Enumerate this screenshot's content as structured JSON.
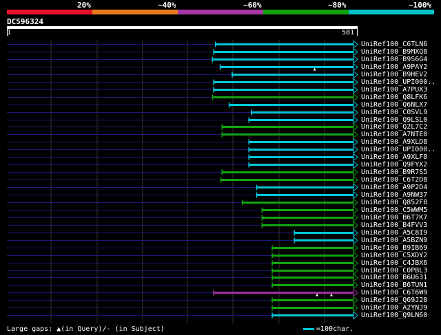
{
  "scale": {
    "labels": [
      "20%",
      "~40%",
      "~60%",
      "~80%",
      "~100%"
    ],
    "colors": [
      "#e8102a",
      "#e87a1e",
      "#a838a8",
      "#10a010",
      "#00c0c8"
    ]
  },
  "query": {
    "name": "DC596324",
    "start": "1",
    "end": "581",
    "length": 581
  },
  "colors": {
    "cyan": "#00c8dc",
    "green": "#10a810",
    "purple": "#a030a0",
    "track": "#1a1a7a",
    "grid": "#333333"
  },
  "hits": [
    {
      "label": "UniRef100_C6TLN6",
      "start": 350,
      "end": 581,
      "color": "cyan"
    },
    {
      "label": "UniRef100_B9MXQ8",
      "start": 347,
      "end": 581,
      "color": "cyan"
    },
    {
      "label": "UniRef100_B9S6G4",
      "start": 345,
      "end": 581,
      "color": "cyan"
    },
    {
      "label": "UniRef100_A9PAY2",
      "start": 358,
      "end": 581,
      "color": "cyan",
      "gap_at": 516
    },
    {
      "label": "UniRef100_B9HEV2",
      "start": 378,
      "end": 581,
      "color": "cyan"
    },
    {
      "label": "UniRef100_UPI000..",
      "start": 347,
      "end": 581,
      "color": "cyan"
    },
    {
      "label": "UniRef100_A7PUX3",
      "start": 347,
      "end": 581,
      "color": "cyan"
    },
    {
      "label": "UniRef100_Q8LFK6",
      "start": 345,
      "end": 581,
      "color": "green"
    },
    {
      "label": "UniRef100_Q6NLX7",
      "start": 373,
      "end": 581,
      "color": "cyan"
    },
    {
      "label": "UniRef100_C0SVL9",
      "start": 410,
      "end": 581,
      "color": "cyan"
    },
    {
      "label": "UniRef100_Q9LSL0",
      "start": 406,
      "end": 581,
      "color": "cyan"
    },
    {
      "label": "UniRef100_Q2L7C2",
      "start": 361,
      "end": 581,
      "color": "green"
    },
    {
      "label": "UniRef100_A7NTE0",
      "start": 361,
      "end": 581,
      "color": "green"
    },
    {
      "label": "UniRef100_A9XLD8",
      "start": 406,
      "end": 581,
      "color": "cyan"
    },
    {
      "label": "UniRef100_UPI000..",
      "start": 406,
      "end": 581,
      "color": "cyan"
    },
    {
      "label": "UniRef100_A9XLF8",
      "start": 406,
      "end": 581,
      "color": "cyan"
    },
    {
      "label": "UniRef100_Q9FYX2",
      "start": 406,
      "end": 581,
      "color": "cyan"
    },
    {
      "label": "UniRef100_B9R7S5",
      "start": 361,
      "end": 581,
      "color": "green"
    },
    {
      "label": "UniRef100_C6T2D8",
      "start": 359,
      "end": 581,
      "color": "green"
    },
    {
      "label": "UniRef100_A9P2D4",
      "start": 419,
      "end": 581,
      "color": "cyan"
    },
    {
      "label": "UniRef100_A9NW37",
      "start": 419,
      "end": 581,
      "color": "cyan"
    },
    {
      "label": "UniRef100_Q852F8",
      "start": 395,
      "end": 581,
      "color": "green"
    },
    {
      "label": "UniRef100_C5WWM5",
      "start": 428,
      "end": 581,
      "color": "green"
    },
    {
      "label": "UniRef100_B6T7K7",
      "start": 428,
      "end": 581,
      "color": "green"
    },
    {
      "label": "UniRef100_B4FVV3",
      "start": 428,
      "end": 581,
      "color": "green"
    },
    {
      "label": "UniRef100_A5C8I9",
      "start": 482,
      "end": 581,
      "color": "cyan"
    },
    {
      "label": "UniRef100_A5BZN9",
      "start": 482,
      "end": 581,
      "color": "cyan"
    },
    {
      "label": "UniRef100_B9IB69",
      "start": 445,
      "end": 581,
      "color": "green"
    },
    {
      "label": "UniRef100_C5XDY2",
      "start": 445,
      "end": 581,
      "color": "green"
    },
    {
      "label": "UniRef100_C4JBX6",
      "start": 445,
      "end": 581,
      "color": "green"
    },
    {
      "label": "UniRef100_C0PBL3",
      "start": 445,
      "end": 581,
      "color": "green"
    },
    {
      "label": "UniRef100_B6U631",
      "start": 445,
      "end": 581,
      "color": "green"
    },
    {
      "label": "UniRef100_B6TUN1",
      "start": 445,
      "end": 581,
      "color": "green"
    },
    {
      "label": "UniRef100_C6T6W9",
      "start": 347,
      "end": 581,
      "color": "purple",
      "gap_at": 520,
      "gap2_at": 544
    },
    {
      "label": "UniRef100_Q69J28",
      "start": 445,
      "end": 581,
      "color": "green"
    },
    {
      "label": "UniRef100_A2YNJ9",
      "start": 445,
      "end": 581,
      "color": "green"
    },
    {
      "label": "UniRef100_Q9LN60",
      "start": 445,
      "end": 581,
      "color": "cyan"
    }
  ],
  "footer": {
    "text": "Large gaps: ▲(in Query)/- (in Subject)"
  },
  "legend": {
    "text": "=100char."
  }
}
